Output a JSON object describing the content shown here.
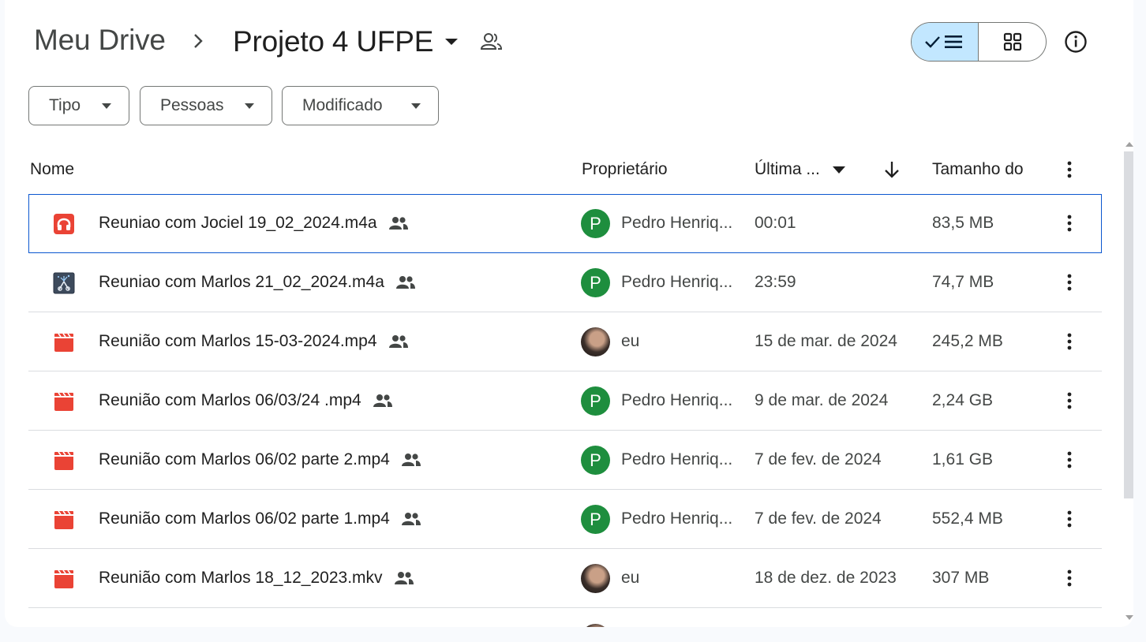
{
  "breadcrumb": {
    "root": "Meu Drive",
    "current": "Projeto 4 UFPE"
  },
  "filters": [
    {
      "label": "Tipo"
    },
    {
      "label": "Pessoas"
    },
    {
      "label": "Modificado"
    }
  ],
  "columns": {
    "name": "Nome",
    "owner": "Proprietário",
    "modified": "Última ...",
    "size": "Tamanho do"
  },
  "files": [
    {
      "name": "Reuniao com Jociel 19_02_2024.m4a",
      "icon": "audio-headphones-icon",
      "owner_initial": "P",
      "owner": "Pedro Henriq...",
      "modified": "00:01",
      "size": "83,5 MB"
    },
    {
      "name": "Reuniao com Marlos 21_02_2024.m4a",
      "icon": "audio-app-icon",
      "owner_initial": "P",
      "owner": "Pedro Henriq...",
      "modified": "23:59",
      "size": "74,7 MB"
    },
    {
      "name": "Reunião com Marlos 15-03-2024.mp4",
      "icon": "video-icon",
      "owner_initial": "",
      "owner": "eu",
      "modified": "15 de mar. de 2024",
      "size": "245,2 MB"
    },
    {
      "name": "Reunião com Marlos 06/03/24 .mp4",
      "icon": "video-icon",
      "owner_initial": "P",
      "owner": "Pedro Henriq...",
      "modified": "9 de mar. de 2024",
      "size": "2,24 GB"
    },
    {
      "name": "Reunião com Marlos 06/02 parte 2.mp4",
      "icon": "video-icon",
      "owner_initial": "P",
      "owner": "Pedro Henriq...",
      "modified": "7 de fev. de 2024",
      "size": "1,61 GB"
    },
    {
      "name": "Reunião com Marlos 06/02 parte 1.mp4",
      "icon": "video-icon",
      "owner_initial": "P",
      "owner": "Pedro Henriq...",
      "modified": "7 de fev. de 2024",
      "size": "552,4 MB"
    },
    {
      "name": "Reunião com Marlos 18_12_2023.mkv",
      "icon": "video-icon",
      "owner_initial": "",
      "owner": "eu",
      "modified": "18 de dez. de 2023",
      "size": "307 MB"
    }
  ],
  "colors": {
    "video": "#ea4335",
    "owner_avatar": "#1e8e3e",
    "selected_outline": "#0b57d0",
    "view_toggle_active": "#c2e7ff"
  }
}
